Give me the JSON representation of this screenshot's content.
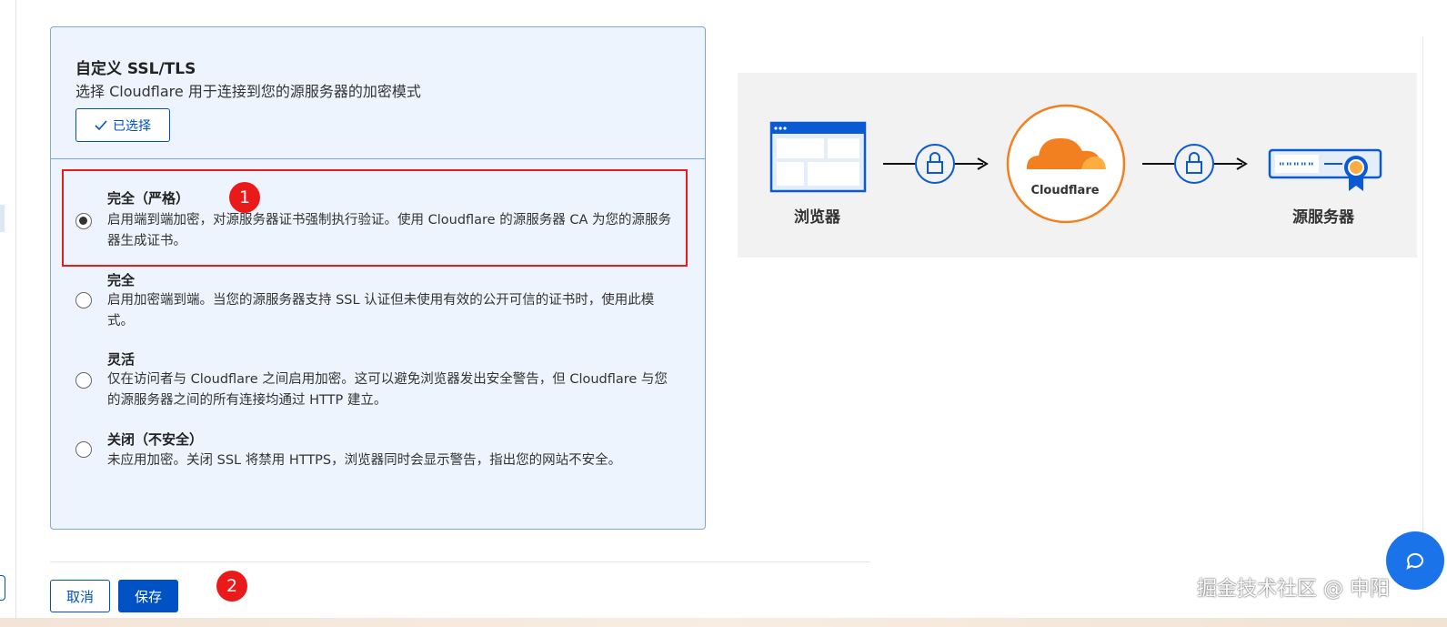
{
  "card": {
    "title": "自定义 SSL/TLS",
    "description": "选择 Cloudflare 用于连接到您的源服务器的加密模式",
    "selected_label": "已选择"
  },
  "options": [
    {
      "title": "完全（严格）",
      "description": "启用端到端加密，对源服务器证书强制执行验证。使用 Cloudflare 的源服务器 CA 为您的源服务器生成证书。",
      "checked": true
    },
    {
      "title": "完全",
      "description": "启用加密端到端。当您的源服务器支持 SSL 认证但未使用有效的公开可信的证书时，使用此模式。",
      "checked": false
    },
    {
      "title": "灵活",
      "description": "仅在访问者与 Cloudflare 之间启用加密。这可以避免浏览器发出安全警告，但 Cloudflare 与您的源服务器之间的所有连接均通过 HTTP 建立。",
      "checked": false
    },
    {
      "title": "关闭（不安全）",
      "description": "未应用加密。关闭 SSL 将禁用 HTTPS，浏览器同时会显示警告，指出您的网站不安全。",
      "checked": false
    }
  ],
  "annotations": {
    "step1": "1",
    "step2": "2"
  },
  "footer": {
    "cancel_label": "取消",
    "save_label": "保存"
  },
  "diagram": {
    "browser_label": "浏览器",
    "cloudflare_label": "Cloudflare",
    "origin_label": "源服务器"
  },
  "watermark": "掘金技术社区 @ 申阳",
  "colors": {
    "accent": "#0051c3",
    "card_bg": "#eef4fd",
    "highlight": "#e81c1c",
    "cloudflare_orange": "#f38020",
    "diagram_blue": "#0a5bd3"
  }
}
